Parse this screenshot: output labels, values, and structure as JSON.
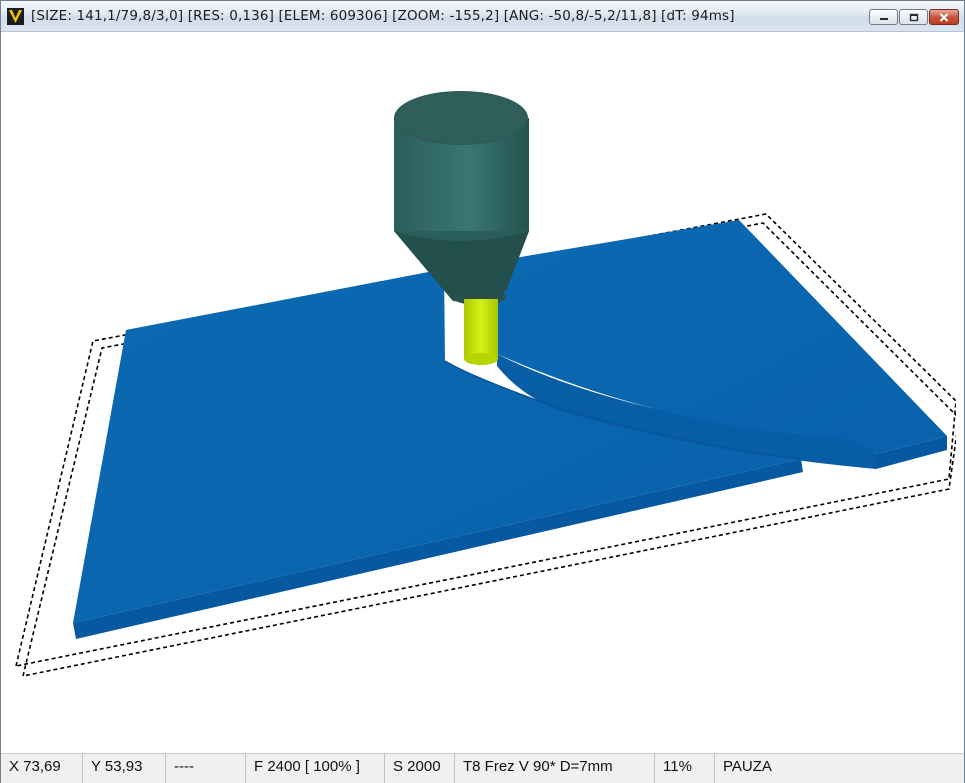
{
  "window": {
    "title": "[SIZE: 141,1/79,8/3,0] [RES: 0,136] [ELEM: 609306] [ZOOM: -155,2] [ANG: -50,8/-5,2/11,8] [dT: 94ms]",
    "icon": "app-v-icon",
    "buttons": [
      "minimize-icon",
      "maximize-icon",
      "close-icon"
    ]
  },
  "viewport": {
    "scene": "3d-milling-simulation",
    "colors": {
      "workpiece_top": "#0a66ae",
      "workpiece_side": "#0659a0",
      "tool_holder": "#2f6562",
      "tool_bit": "#c9ea08",
      "boundary": "#000000",
      "background": "#ffffff"
    }
  },
  "status": {
    "x": "X 73,69",
    "y": "Y 53,93",
    "mode": "----",
    "feed": "F 2400 [ 100% ]",
    "spindle": "S 2000",
    "tool": "T8 Frez V 90* D=7mm",
    "progress": "11%",
    "state": "PAUZA"
  }
}
